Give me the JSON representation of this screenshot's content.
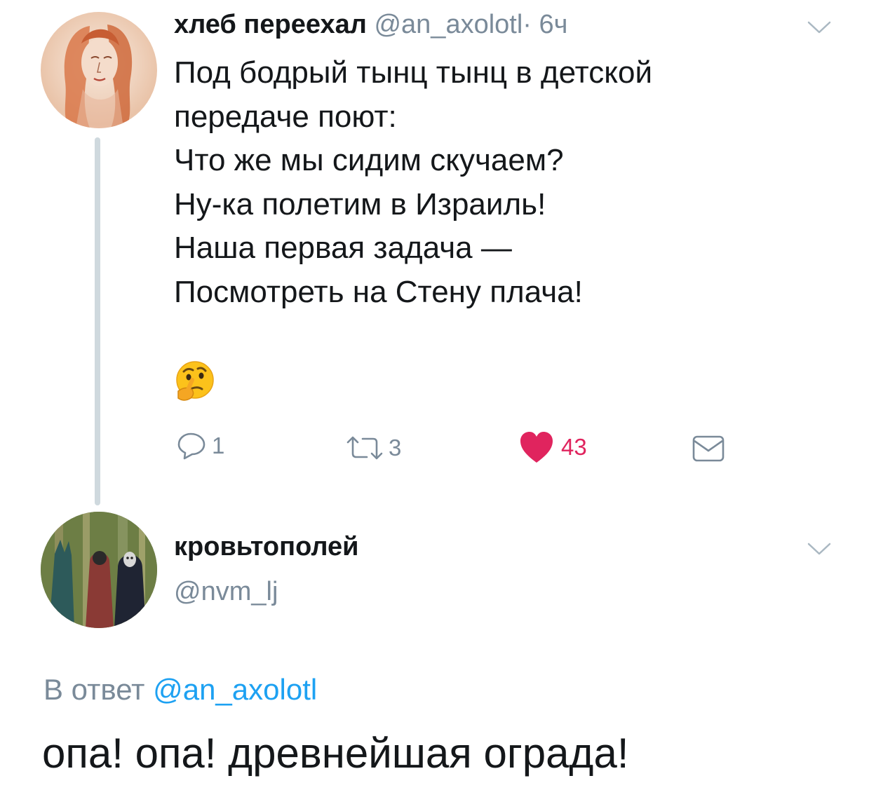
{
  "tweet": {
    "display_name": "хлеб переехал",
    "handle": "@an_axolotl",
    "time_separator": "·",
    "time": "6ч",
    "lines": [
      "Под бодрый тынц тынц в детской",
      "передаче поют:",
      "Что же мы сидим скучаем?",
      "Ну-ка полетим в Израиль!",
      "Наша первая задача —",
      "Посмотреть на Стену плача!"
    ],
    "emoji": "🤔",
    "actions": {
      "reply_count": "1",
      "retweet_count": "3",
      "like_count": "43"
    },
    "colors": {
      "like": "#e0245e",
      "muted": "#7a8a99",
      "thread": "#cfd9de"
    }
  },
  "reply": {
    "display_name": "кровьтополей",
    "handle": "@nvm_lj",
    "reply_prefix": "В ответ",
    "reply_to": "@an_axolotl",
    "text": "опа! опа! древнейшая ограда!",
    "colors": {
      "mention": "#1da1f2"
    }
  }
}
